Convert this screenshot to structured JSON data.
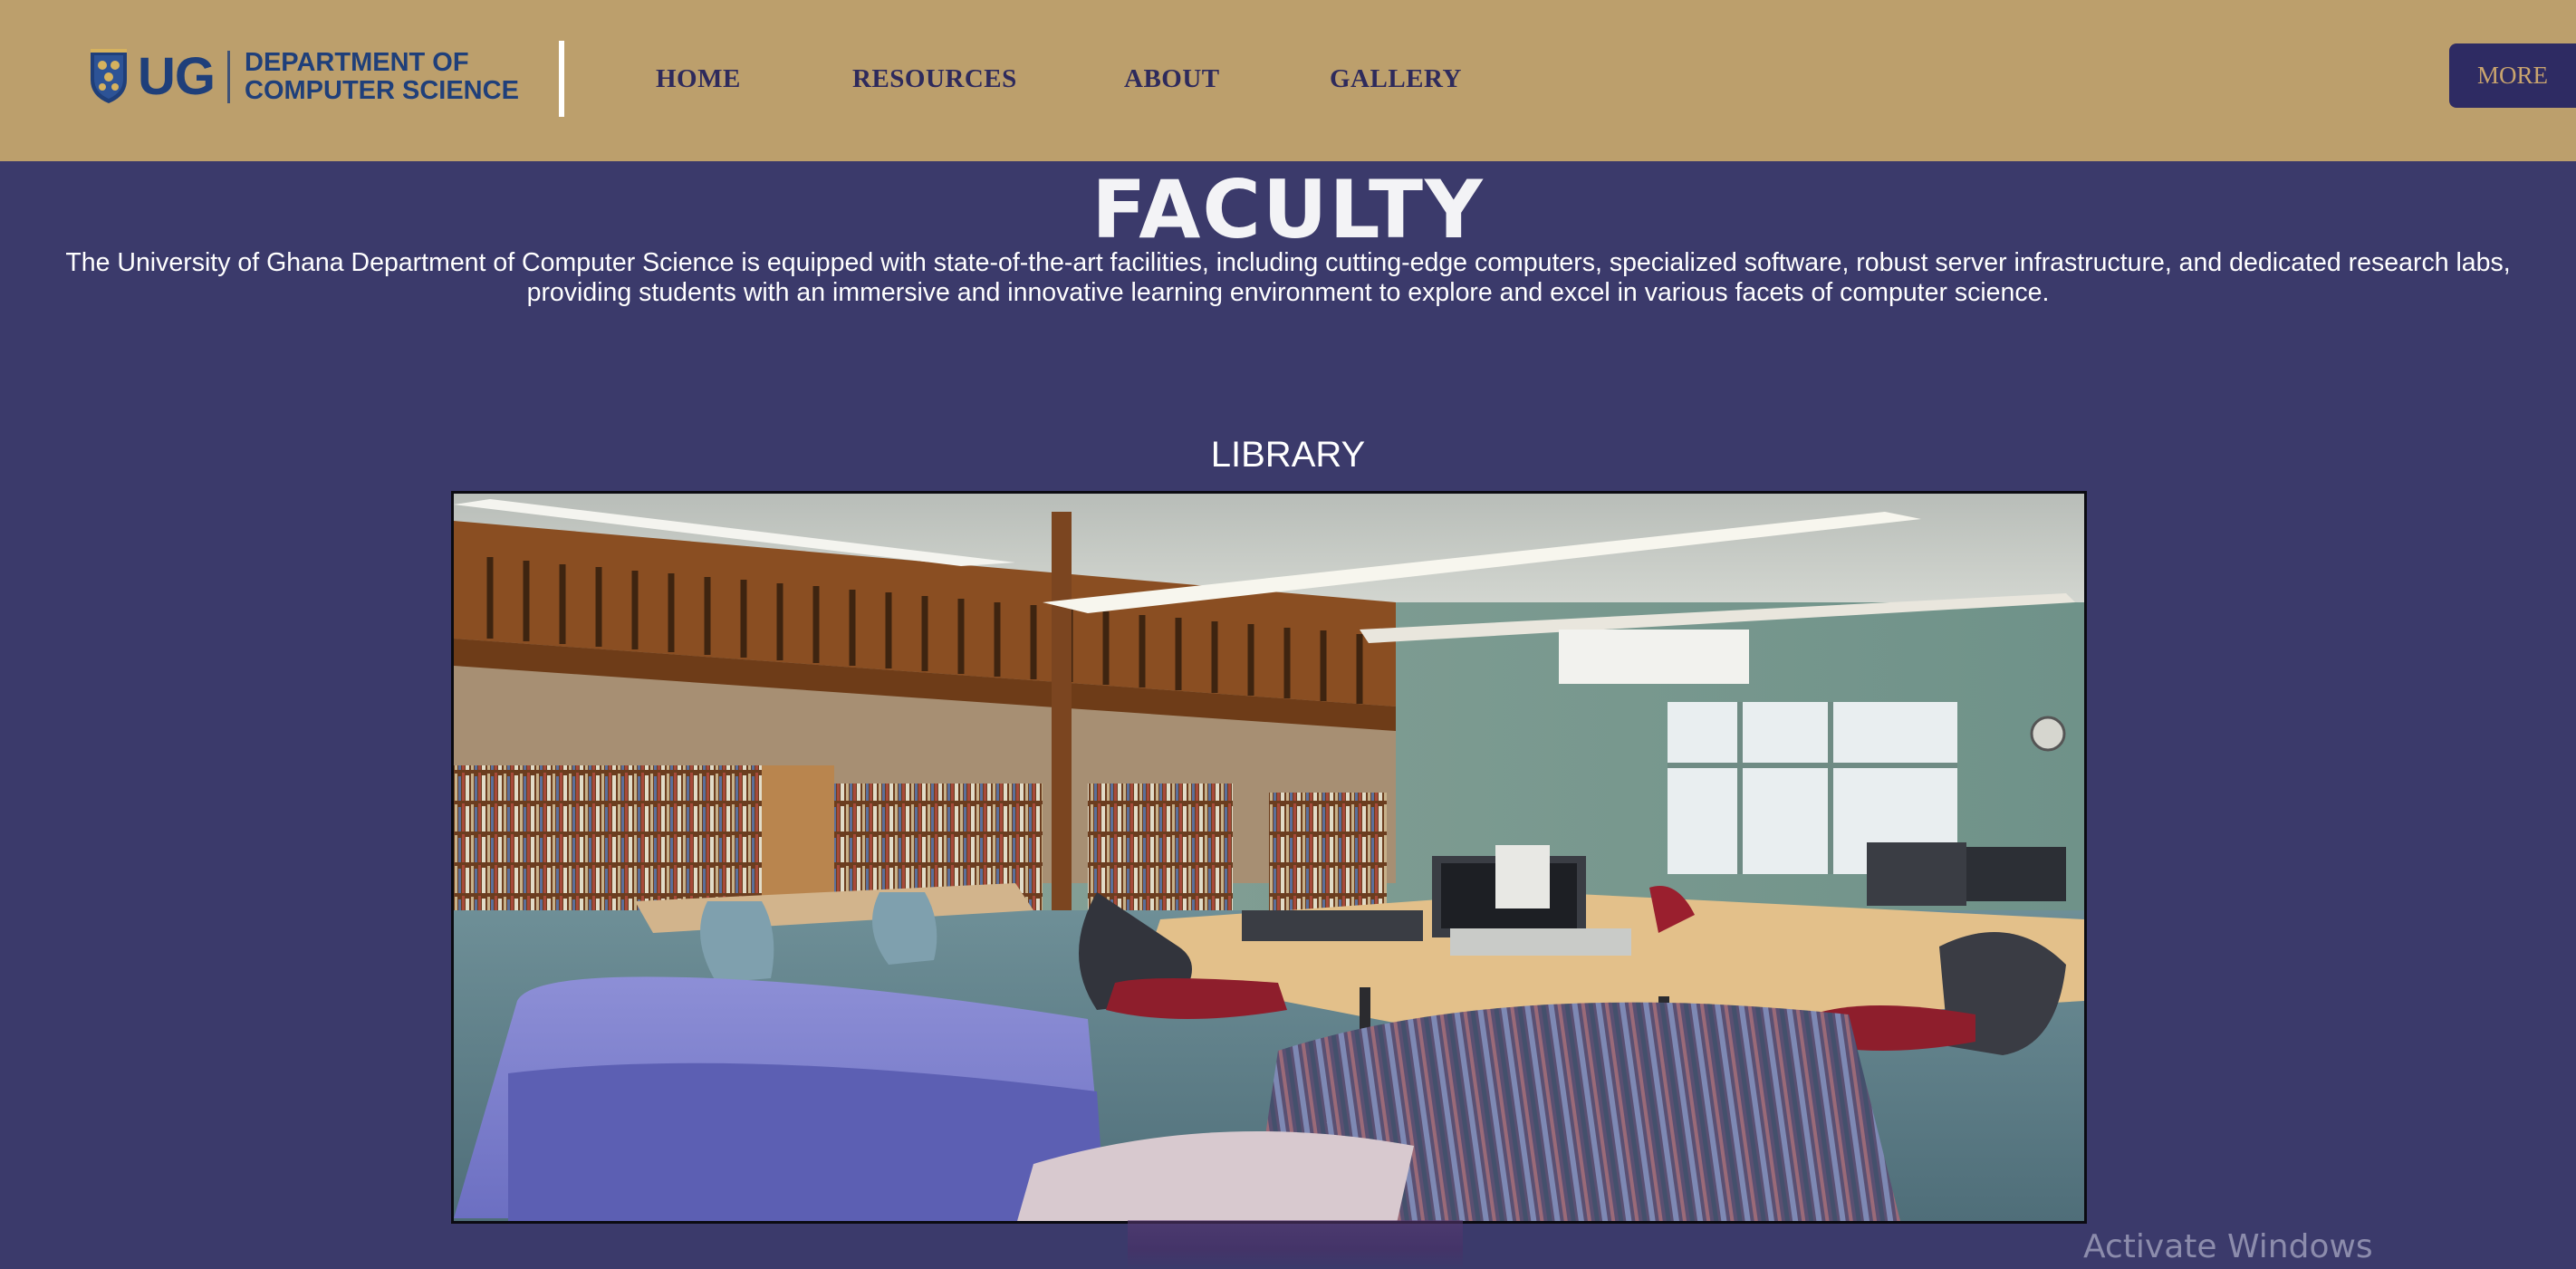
{
  "header": {
    "logo": {
      "mark": "UG",
      "line1": "DEPARTMENT OF",
      "line2": "COMPUTER SCIENCE"
    },
    "nav": [
      {
        "label": "HOME"
      },
      {
        "label": "RESOURCES"
      },
      {
        "label": "ABOUT"
      },
      {
        "label": "GALLERY"
      }
    ],
    "more_button": "MORE"
  },
  "main": {
    "title": "FACULTY",
    "intro": "The University of Ghana Department of Computer Science is equipped with state-of-the-art facilities, including cutting-edge computers, specialized software, robust server infrastructure, and dedicated research labs, providing students with an immersive and innovative learning environment to explore and excel in various facets of computer science.",
    "section": {
      "title": "LIBRARY",
      "image": "library-photo"
    }
  },
  "os_overlay": {
    "watermark": "Activate Windows"
  },
  "colors": {
    "header_bg": "#bc9f6c",
    "page_bg": "#3b3a6b",
    "nav_text": "#2e2a5c",
    "logo_blue": "#1f3f7a",
    "more_bg": "#2e2b63",
    "more_text": "#c9a46e"
  },
  "icons": [
    "ug-crest-icon"
  ]
}
